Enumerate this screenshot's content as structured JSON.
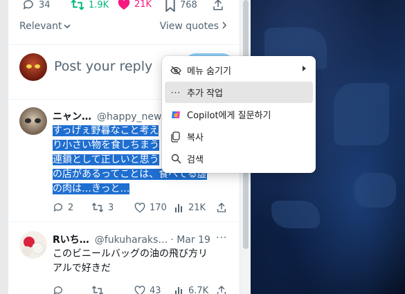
{
  "top_stats": {
    "replies": "34",
    "reposts": "1.9K",
    "likes": "21K",
    "bookmarks": "768"
  },
  "sort": {
    "label": "Relevant",
    "view_quotes": "View quotes"
  },
  "reply_box": {
    "placeholder": "Post your reply"
  },
  "tweets": [
    {
      "name": "ニャン…",
      "handle": "@happy_new…",
      "lines": [
        "すっげぇ野暮なこと考え",
        "り小さい物を食しちまう",
        "連鎖として正しいと思う",
        "の店があるってことは、食べてる虚",
        "の肉は…きっと…"
      ],
      "stats": {
        "replies": "2",
        "reposts": "3",
        "likes": "170",
        "views": "21K"
      }
    },
    {
      "name": "Rいち…",
      "handle": "@fukuharaks…",
      "date": "· Mar 19",
      "lines": [
        "このビニールバッグの油の飛び方リ",
        "アルで好きだ"
      ],
      "stats": {
        "replies": "",
        "reposts": "",
        "likes": "43",
        "views": "6.7K"
      }
    }
  ],
  "context_menu": {
    "items": [
      {
        "label": "메뉴 숨기기",
        "icon": "eye-off-icon",
        "submenu": true
      },
      {
        "label": "추가 작업",
        "icon": "ellipsis-icon",
        "submenu": false
      },
      {
        "label": "Copilot에게 질문하기",
        "icon": "copilot-icon",
        "submenu": false
      },
      {
        "label": "복사",
        "icon": "copy-icon",
        "submenu": false
      },
      {
        "label": "검색",
        "icon": "search-icon",
        "submenu": false
      }
    ]
  },
  "colors": {
    "like_active": "#f91880",
    "repost_active": "#00ba7c",
    "selection": "#1f6fd1",
    "muted": "#536471"
  }
}
